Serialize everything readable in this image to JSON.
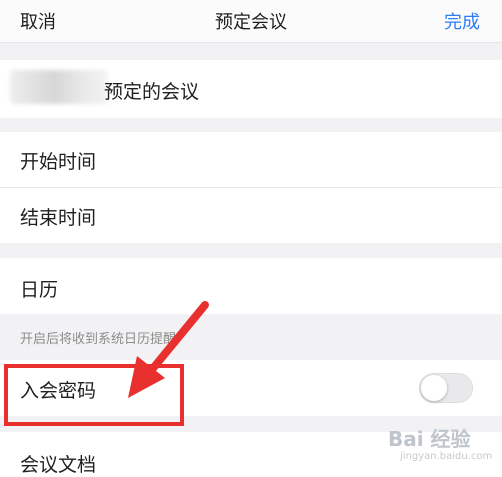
{
  "nav": {
    "cancel_label": "取消",
    "title": "预定会议",
    "done_label": "完成"
  },
  "meeting": {
    "name_suffix": "预定的会议"
  },
  "rows": {
    "start_time": "开始时间",
    "end_time": "结束时间",
    "calendar": "日历",
    "calendar_hint": "开启后将收到系统日历提醒",
    "meeting_password": "入会密码",
    "meeting_docs": "会议文档"
  },
  "toggle": {
    "meeting_password_on": false
  },
  "annotation": {
    "highlight_color": "#e8312f"
  },
  "watermark": {
    "logo_text": "Bai 经验",
    "url": "jingyan.baidu.com"
  },
  "colors": {
    "accent": "#2d7df6",
    "background": "#f2f2f4"
  }
}
